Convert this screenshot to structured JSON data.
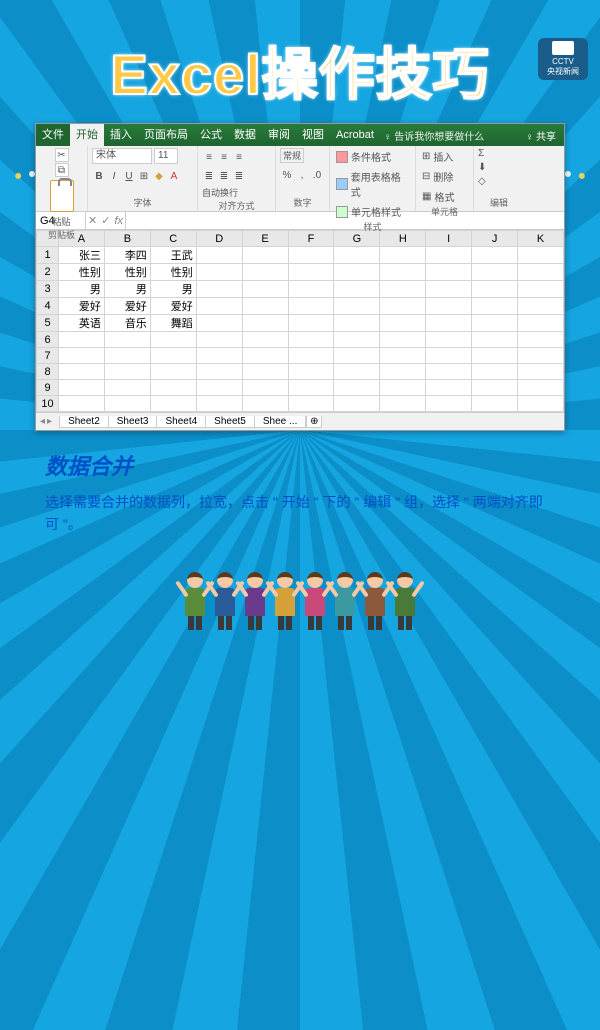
{
  "logo": {
    "line1": "CCTV",
    "line2": "央视新闻"
  },
  "title": "Excel操作技巧",
  "tabs": {
    "file": "文件",
    "home": "开始",
    "insert": "插入",
    "layout": "页面布局",
    "formulas": "公式",
    "data": "数据",
    "review": "审阅",
    "view": "视图",
    "acrobat": "Acrobat",
    "tell_me": "♀ 告诉我你想要做什么",
    "share": "♀ 共享"
  },
  "ribbon": {
    "clipboard": {
      "label": "剪贴板",
      "paste": "粘贴"
    },
    "font": {
      "label": "字体",
      "name": "宋体",
      "size": "11",
      "buttons": [
        "B",
        "I",
        "U",
        "⊞",
        "◇",
        "A"
      ]
    },
    "alignment": {
      "label": "对齐方式",
      "wrap": "自动换行",
      "merge": "⊞"
    },
    "number": {
      "label": "数字",
      "format": "常规"
    },
    "styles": {
      "label": "样式",
      "cond": "条件格式",
      "table": "套用表格格式",
      "cell": "单元格样式"
    },
    "cells": {
      "label": "单元格",
      "insert": "插入",
      "delete": "删除",
      "format": "格式"
    },
    "editing": {
      "label": "编辑",
      "sum": "Σ",
      "fill": "⬇",
      "clear": "◇"
    }
  },
  "formula_bar": {
    "name_box": "G4",
    "fx": "fx"
  },
  "grid": {
    "cols": [
      "A",
      "B",
      "C",
      "D",
      "E",
      "F",
      "G",
      "H",
      "I",
      "J",
      "K"
    ],
    "rows": [
      {
        "n": "1",
        "cells": [
          "张三",
          "李四",
          "王武",
          "",
          "",
          "",
          "",
          "",
          "",
          "",
          ""
        ]
      },
      {
        "n": "2",
        "cells": [
          "性别",
          "性别",
          "性别",
          "",
          "",
          "",
          "",
          "",
          "",
          "",
          ""
        ]
      },
      {
        "n": "3",
        "cells": [
          "男",
          "男",
          "男",
          "",
          "",
          "",
          "",
          "",
          "",
          "",
          ""
        ]
      },
      {
        "n": "4",
        "cells": [
          "爱好",
          "爱好",
          "爱好",
          "",
          "",
          "",
          "",
          "",
          "",
          "",
          ""
        ]
      },
      {
        "n": "5",
        "cells": [
          "英语",
          "音乐",
          "舞蹈",
          "",
          "",
          "",
          "",
          "",
          "",
          "",
          ""
        ]
      },
      {
        "n": "6",
        "cells": [
          "",
          "",
          "",
          "",
          "",
          "",
          "",
          "",
          "",
          "",
          ""
        ]
      },
      {
        "n": "7",
        "cells": [
          "",
          "",
          "",
          "",
          "",
          "",
          "",
          "",
          "",
          "",
          ""
        ]
      },
      {
        "n": "8",
        "cells": [
          "",
          "",
          "",
          "",
          "",
          "",
          "",
          "",
          "",
          "",
          ""
        ]
      },
      {
        "n": "9",
        "cells": [
          "",
          "",
          "",
          "",
          "",
          "",
          "",
          "",
          "",
          "",
          ""
        ]
      },
      {
        "n": "10",
        "cells": [
          "",
          "",
          "",
          "",
          "",
          "",
          "",
          "",
          "",
          "",
          ""
        ]
      }
    ]
  },
  "sheets": {
    "nav": [
      "◂",
      "▸"
    ],
    "tabs": [
      "Sheet2",
      "Sheet3",
      "Sheet4",
      "Sheet5",
      "Shee ..."
    ],
    "add": "⊕"
  },
  "section": {
    "title": "数据合并",
    "body": "选择需要合并的数据列，拉宽，点击 \" 开始 \" 下的 \" 编辑 \" 组，选择 \" 两端对齐即可 \"。"
  },
  "people_colors": [
    "#5a8c3a",
    "#2a5c9a",
    "#6b3a8c",
    "#d4a03a",
    "#c94a7a",
    "#3a9aa0",
    "#8c5a3a",
    "#4a7a3a"
  ]
}
